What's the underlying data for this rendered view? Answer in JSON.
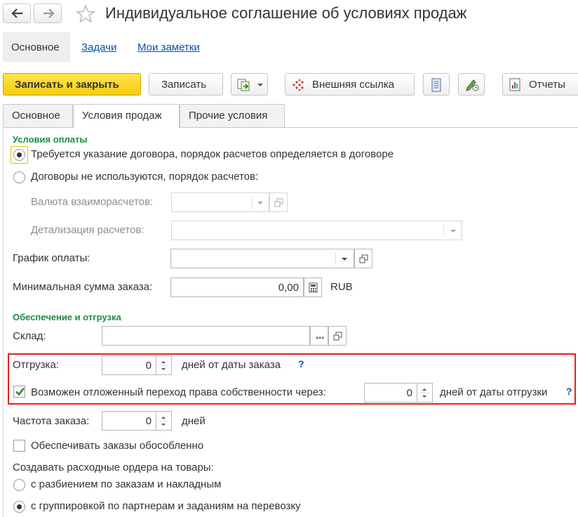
{
  "window": {
    "title": "Индивидуальное соглашение об условиях продаж"
  },
  "top_nav": {
    "main": "Основное",
    "tasks": "Задачи",
    "notes": "Мои заметки"
  },
  "toolbar": {
    "save_close": "Записать и закрыть",
    "save": "Записать",
    "external_link": "Внешняя ссылка",
    "reports": "Отчеты"
  },
  "tabs": {
    "main": "Основное",
    "sales": "Условия продаж",
    "other": "Прочие условия"
  },
  "payment": {
    "section": "Условия оплаты",
    "opt_contract": "Требуется указание договора, порядок расчетов определяется в договоре",
    "opt_no_contract": "Договоры не используются, порядок расчетов:",
    "currency_label": "Валюта взаиморасчетов:",
    "detail_label": "Детализация расчетов:",
    "schedule_label": "График оплаты:",
    "min_sum_label": "Минимальная сумма заказа:",
    "min_sum_value": "0,00",
    "currency_code": "RUB"
  },
  "shipping": {
    "section": "Обеспечение и отгрузка",
    "warehouse_label": "Склад:",
    "ellipsis": "...",
    "shipment_label": "Отгрузка:",
    "shipment_value": "0",
    "shipment_unit": "дней от даты заказа",
    "help_mark": "?",
    "ownership_label": "Возможен отложенный переход права собственности через:",
    "ownership_value": "0",
    "ownership_unit": "дней от даты отгрузки",
    "frequency_label": "Частота заказа:",
    "frequency_value": "0",
    "frequency_unit": "дней",
    "separate_label": "Обеспечивать заказы обособленно",
    "orders_label": "Создавать расходные ордера на товары:",
    "opt_split": "с разбиением по заказам и накладным",
    "opt_group": "с группировкой по партнерам и заданиям на перевозку"
  },
  "colors": {
    "accent": "#f4cd0e",
    "section": "#1e8a45",
    "link": "#0a4fa8",
    "highlight": "#e0221a"
  }
}
